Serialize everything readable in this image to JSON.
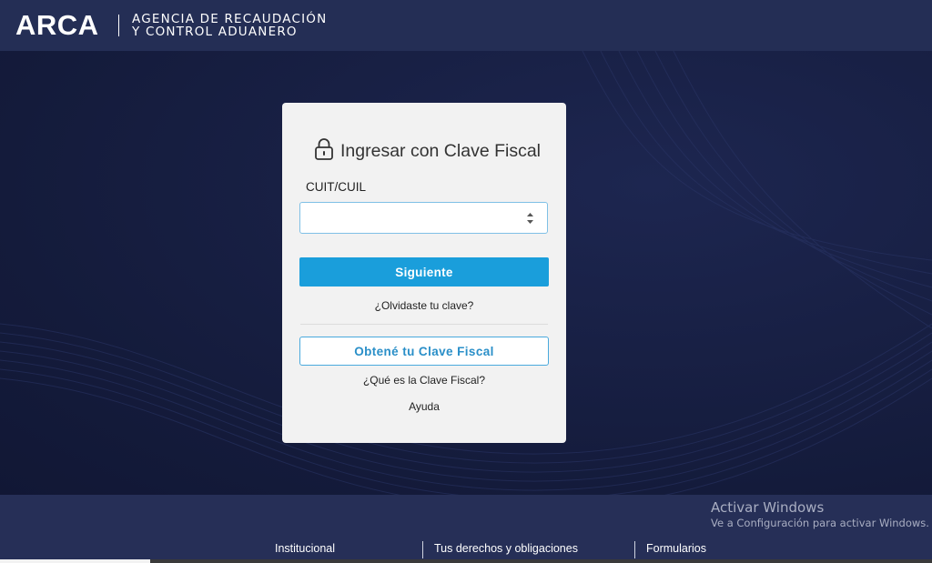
{
  "header": {
    "logo": "ARCA",
    "agency_line1": "AGENCIA DE RECAUDACIÓN",
    "agency_line2": "Y CONTROL ADUANERO"
  },
  "login": {
    "title": "Ingresar con Clave Fiscal",
    "lock_icon": "lock-icon",
    "cuit_label": "CUIT/CUIL",
    "cuit_value": "",
    "next_button": "Siguiente",
    "forgot_link": "¿Olvidaste tu clave?",
    "get_key_button": "Obtené tu Clave Fiscal",
    "what_is_link": "¿Qué es la Clave Fiscal?",
    "help_link": "Ayuda"
  },
  "watermark": {
    "title": "Activar Windows",
    "subtitle": "Ve a Configuración para activar Windows."
  },
  "footer": {
    "links": [
      "Institucional",
      "Tus derechos y obligaciones",
      "Formularios"
    ]
  },
  "colors": {
    "header_bg": "#242e55",
    "hero_bg": "#141b3b",
    "primary_button": "#1a9edb",
    "outline_button": "#49a9dd"
  }
}
